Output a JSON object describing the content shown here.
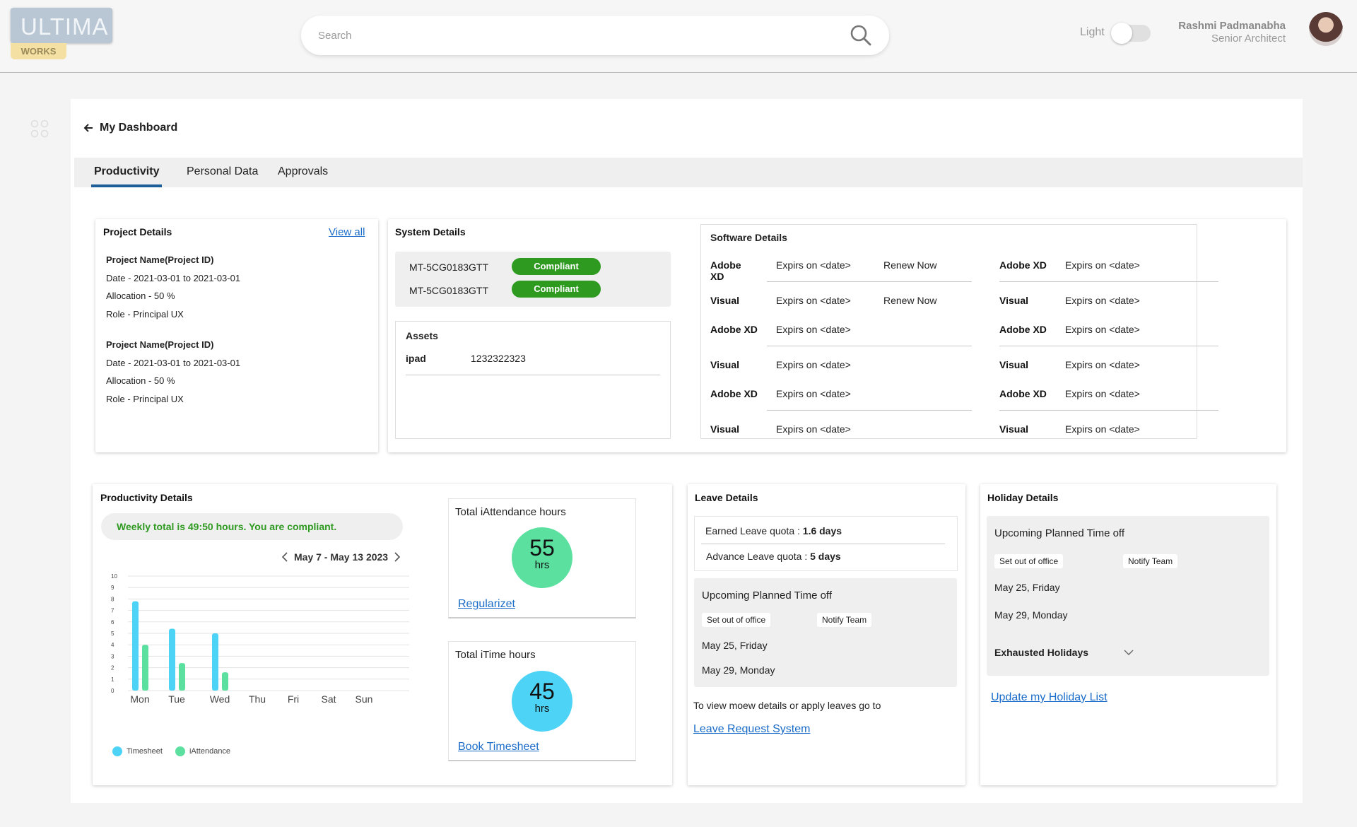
{
  "app": {
    "logo_text": "ULTIMA",
    "logo_sub": "WORKS"
  },
  "search": {
    "placeholder": "Search"
  },
  "theme": {
    "label": "Light"
  },
  "user": {
    "name": "Rashmi Padmanabha",
    "role": "Senior Architect"
  },
  "page": {
    "title": "My Dashboard"
  },
  "tabs": [
    {
      "label": "Productivity",
      "active": true
    },
    {
      "label": "Personal Data",
      "active": false
    },
    {
      "label": "Approvals",
      "active": false
    }
  ],
  "project_details": {
    "title": "Project Details",
    "view_all": "View all",
    "projects": [
      {
        "name": "Project Name(Project ID)",
        "date": "Date -  2021-03-01 to 2021-03-01",
        "allocation": "Allocation  - 50 %",
        "role": "Role - Principal UX"
      },
      {
        "name": "Project Name(Project ID)",
        "date": "Date -  2021-03-01 to 2021-03-01",
        "allocation": "Allocation  - 50 %",
        "role": "Role - Principal UX"
      }
    ]
  },
  "system_details": {
    "title": "System Details",
    "systems": [
      {
        "id": "MT-5CG0183GTT",
        "status": "Compliant"
      },
      {
        "id": "MT-5CG0183GTT",
        "status": "Compliant"
      }
    ],
    "assets_title": "Assets",
    "assets": [
      {
        "name": "ipad",
        "value": "1232322323"
      }
    ]
  },
  "software_details": {
    "title": "Software Details",
    "left": [
      {
        "name": "Adobe XD",
        "expiry": "Expirs on <date>",
        "action": "Renew Now"
      },
      {
        "name": "Visual",
        "expiry": "Expirs on <date>",
        "action": "Renew Now"
      },
      {
        "name": "Adobe XD",
        "expiry": "Expirs on <date>",
        "action": ""
      },
      {
        "name": "Visual",
        "expiry": "Expirs on <date>",
        "action": ""
      },
      {
        "name": "Adobe XD",
        "expiry": "Expirs on <date>",
        "action": ""
      },
      {
        "name": "Visual",
        "expiry": "Expirs on <date>",
        "action": ""
      }
    ],
    "right": [
      {
        "name": "Adobe XD",
        "expiry": "Expirs on <date>"
      },
      {
        "name": "Visual",
        "expiry": "Expirs on <date>"
      },
      {
        "name": "Adobe XD",
        "expiry": "Expirs on <date>"
      },
      {
        "name": "Visual",
        "expiry": "Expirs on <date>"
      },
      {
        "name": "Adobe XD",
        "expiry": "Expirs on <date>"
      },
      {
        "name": "Visual",
        "expiry": "Expirs on <date>"
      }
    ]
  },
  "productivity": {
    "title": "Productivity Details",
    "banner": "Weekly total is 49:50 hours. You are compliant.",
    "week_label": "May 7 - May  13 2023",
    "legend": {
      "timesheet": "Timesheet",
      "iattendance": "iAttendance"
    },
    "colors": {
      "timesheet": "#4dd3f5",
      "iattendance": "#5be0a0",
      "banner_text": "#2e9a20"
    }
  },
  "chart_data": {
    "type": "bar",
    "categories": [
      "Mon",
      "Tue",
      "Wed",
      "Thu",
      "Fri",
      "Sat",
      "Sun"
    ],
    "series": [
      {
        "name": "Timesheet",
        "values": [
          7.8,
          5.4,
          5.0,
          0,
          0,
          0,
          0
        ]
      },
      {
        "name": "iAttendance",
        "values": [
          4.0,
          2.4,
          1.6,
          0,
          0,
          0,
          0
        ]
      }
    ],
    "yticks": [
      "0",
      "1",
      "2",
      "3",
      "4",
      "5",
      "6",
      "7",
      "8",
      "9",
      "10"
    ],
    "ylim": [
      0,
      10
    ],
    "grid": true,
    "legend": "bottom-left"
  },
  "attendance": {
    "title": "Total iAttendance hours",
    "value": "55",
    "unit": "hrs",
    "link": "Regularizet",
    "color": "#5be0a0"
  },
  "itime": {
    "title": "Total iTime  hours",
    "value": "45",
    "unit": "hrs",
    "link": "Book Timesheet",
    "color": "#4dd3f5"
  },
  "leave": {
    "title": "Leave Details",
    "earned_label": "Earned Leave quota : ",
    "earned_value": "1.6 days",
    "advance_label": "Advance Leave quota : ",
    "advance_value": "5 days",
    "upcoming_title": "Upcoming Planned Time off",
    "set_ooo": "Set out of office",
    "notify": "Notify Team",
    "dates": [
      "May 25, Friday",
      "May 29, Monday"
    ],
    "info": "To view moew details or apply leaves go to",
    "link": "Leave Request System"
  },
  "holiday": {
    "title": "Holiday Details",
    "upcoming_title": "Upcoming Planned Time off",
    "set_ooo": "Set out of office",
    "notify": "Notify Team",
    "dates": [
      "May 25, Friday",
      "May 29, Monday"
    ],
    "exhausted": "Exhausted Holidays",
    "link": "Update my Holiday List"
  }
}
